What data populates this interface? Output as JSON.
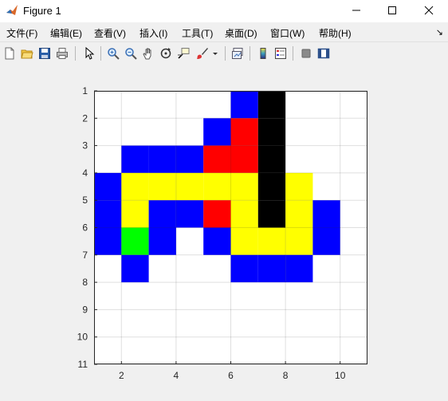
{
  "window": {
    "title": "Figure 1"
  },
  "menu": [
    {
      "id": "file",
      "label": "文件(F)"
    },
    {
      "id": "edit",
      "label": "编辑(E)"
    },
    {
      "id": "view",
      "label": "查看(V)"
    },
    {
      "id": "insert",
      "label": "插入(I)"
    },
    {
      "id": "tools",
      "label": "工具(T)"
    },
    {
      "id": "desktop",
      "label": "桌面(D)"
    },
    {
      "id": "window",
      "label": "窗口(W)"
    },
    {
      "id": "help",
      "label": "帮助(H)"
    }
  ],
  "toolbar": {
    "icons": [
      "new-figure-icon",
      "open-file-icon",
      "save-icon",
      "print-icon",
      "select-arrow-icon",
      "zoom-in-icon",
      "zoom-out-icon",
      "pan-hand-icon",
      "rotate-3d-icon",
      "data-cursor-icon",
      "brush-icon",
      "link-plot-icon",
      "insert-colorbar-icon",
      "insert-legend-icon",
      "hide-plot-tools-icon",
      "show-plot-tools-icon"
    ]
  },
  "chart_data": {
    "type": "heatmap",
    "title": "",
    "xlabel": "",
    "ylabel": "",
    "xlim": [
      1,
      11
    ],
    "ylim": [
      1,
      11
    ],
    "y_reversed": true,
    "xticks": [
      2,
      4,
      6,
      8,
      10
    ],
    "yticks": [
      1,
      2,
      3,
      4,
      5,
      6,
      7,
      8,
      9,
      10,
      11
    ],
    "grid": true,
    "colors": {
      "0": "#ffffff",
      "1": "#0000ff",
      "2": "#ff0000",
      "3": "#000000",
      "4": "#ffff00",
      "5": "#00ff00"
    },
    "cells": [
      [
        0,
        0,
        0,
        0,
        0,
        1,
        3,
        0,
        0,
        0
      ],
      [
        0,
        0,
        0,
        0,
        1,
        2,
        3,
        0,
        0,
        0
      ],
      [
        0,
        1,
        1,
        1,
        2,
        2,
        3,
        0,
        0,
        0
      ],
      [
        1,
        4,
        4,
        4,
        4,
        4,
        3,
        4,
        0,
        0
      ],
      [
        1,
        4,
        1,
        1,
        2,
        4,
        3,
        4,
        1,
        0
      ],
      [
        1,
        5,
        1,
        0,
        1,
        4,
        4,
        4,
        1,
        0
      ],
      [
        0,
        1,
        0,
        0,
        0,
        1,
        1,
        1,
        0,
        0
      ],
      [
        0,
        0,
        0,
        0,
        0,
        0,
        0,
        0,
        0,
        0
      ],
      [
        0,
        0,
        0,
        0,
        0,
        0,
        0,
        0,
        0,
        0
      ],
      [
        0,
        0,
        0,
        0,
        0,
        0,
        0,
        0,
        0,
        0
      ]
    ]
  }
}
